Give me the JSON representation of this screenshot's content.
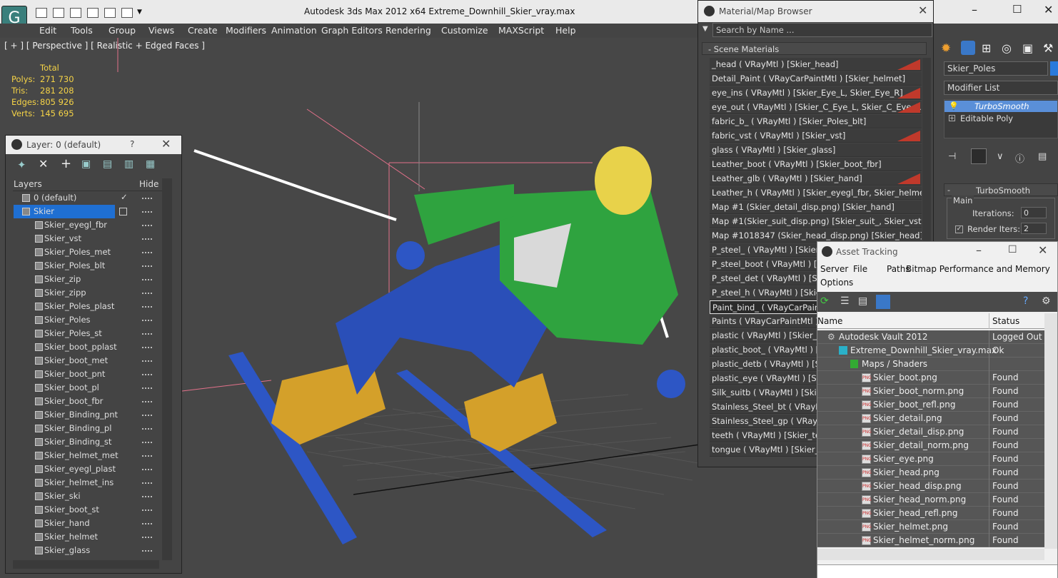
{
  "app": {
    "title": "Autodesk 3ds Max  2012 x64     Extreme_Downhill_Skier_vray.max"
  },
  "menu": [
    "Edit",
    "Tools",
    "Group",
    "Views",
    "Create",
    "Modifiers",
    "Animation",
    "Graph Editors",
    "Rendering",
    "Customize",
    "MAXScript",
    "Help"
  ],
  "viewport": {
    "label": "[ + ] [ Perspective ] [ Realistic + Edged Faces ]",
    "stats": {
      "header": "Total",
      "polys_label": "Polys:",
      "polys": "271 730",
      "tris_label": "Tris:",
      "tris": "281 208",
      "edges_label": "Edges:",
      "edges": "805 926",
      "verts_label": "Verts:",
      "verts": "145 695"
    }
  },
  "layer_panel": {
    "title": "Layer: 0 (default)",
    "help": "?",
    "col_layers": "Layers",
    "col_hide": "Hide",
    "rows": [
      "0 (default)",
      "Skier",
      "Skier_eyegl_fbr",
      "Skier_vst",
      "Skier_Poles_met",
      "Skier_Poles_blt",
      "Skier_zip",
      "Skier_zipp",
      "Skier_Poles_plast",
      "Skier_Poles",
      "Skier_Poles_st",
      "Skier_boot_pplast",
      "Skier_boot_met",
      "Skier_boot_pnt",
      "Skier_boot_pl",
      "Skier_boot_fbr",
      "Skier_Binding_pnt",
      "Skier_Binding_pl",
      "Skier_Binding_st",
      "Skier_helmet_met",
      "Skier_eyegl_plast",
      "Skier_helmet_ins",
      "Skier_ski",
      "Skier_boot_st",
      "Skier_hand",
      "Skier_helmet",
      "Skier_glass"
    ]
  },
  "material_browser": {
    "title": "Material/Map Browser",
    "search_placeholder": "Search by Name ...",
    "section": "- Scene Materials",
    "rows": [
      "_head  ( VRayMtl ) [Skier_head]",
      "Detail_Paint  ( VRayCarPaintMtl ) [Skier_helmet]",
      "eye_ins  ( VRayMtl ) [Skier_Eye_L, Skier_Eye_R]",
      "eye_out  ( VRayMtl ) [Skier_C_Eye_L, Skier_C_Eye_R]",
      "fabric_b_  ( VRayMtl ) [Skier_Poles_blt]",
      "fabric_vst  ( VRayMtl ) [Skier_vst]",
      "glass  ( VRayMtl ) [Skier_glass]",
      "Leather_boot  ( VRayMtl ) [Skier_boot_fbr]",
      "Leather_glb  ( VRayMtl ) [Skier_hand]",
      "Leather_h  ( VRayMtl ) [Skier_eyegl_fbr, Skier_helmet_...",
      "Map #1 (Skier_detail_disp.png) [Skier_hand]",
      "Map #1(Skier_suit_disp.png) [Skier_suit_, Skier_vst]",
      "Map #1018347 (Skier_head_disp.png) [Skier_head]",
      "P_steel_  ( VRayMtl ) [Skier_",
      "P_steel_boot  ( VRayMtl ) [S",
      "P_steel_det  ( VRayMtl ) [Sk",
      "P_steel_h  ( VRayMtl ) [Skie",
      "Paint_bind_  ( VRayCarPaint",
      "Paints  ( VRayCarPaintMtl ) [",
      "plastic  ( VRayMtl ) [Skier_Bi",
      "plastic_boot_  ( VRayMtl ) [S",
      "plastic_detb  ( VRayMtl ) [Sk",
      "plastic_eye  ( VRayMtl ) [Ski",
      "Silk_suitb  ( VRayMtl ) [Skie",
      "Stainless_Steel_bt  ( VRayM",
      "Stainless_Steel_gp  ( VRayM",
      "teeth  ( VRayMtl ) [Skier_tee",
      "tongue  ( VRayMtl ) [Skier_c"
    ],
    "red_rows": [
      0,
      2,
      3,
      5,
      8
    ]
  },
  "command_panel": {
    "object_name": "Skier_Poles",
    "modifier_list": "Modifier List",
    "stack": [
      "TurboSmooth",
      "Editable Poly"
    ],
    "rollout": "TurboSmooth",
    "main": "Main",
    "iterations_label": "Iterations:",
    "iterations": "0",
    "render_iters_label": "Render Iters:",
    "render_iters": "2"
  },
  "asset_tracking": {
    "title": "Asset Tracking",
    "menu": [
      "Server",
      "File",
      "Paths",
      "Bitmap Performance and Memory",
      "Options"
    ],
    "col_name": "Name",
    "col_status": "Status",
    "rows": [
      {
        "name": "Autodesk Vault 2012",
        "status": "Logged Out ."
      },
      {
        "name": "Extreme_Downhill_Skier_vray.max",
        "status": "Ok"
      },
      {
        "name": "Maps / Shaders",
        "status": ""
      },
      {
        "name": "Skier_boot.png",
        "status": "Found"
      },
      {
        "name": "Skier_boot_norm.png",
        "status": "Found"
      },
      {
        "name": "Skier_boot_refl.png",
        "status": "Found"
      },
      {
        "name": "Skier_detail.png",
        "status": "Found"
      },
      {
        "name": "Skier_detail_disp.png",
        "status": "Found"
      },
      {
        "name": "Skier_detail_norm.png",
        "status": "Found"
      },
      {
        "name": "Skier_eye.png",
        "status": "Found"
      },
      {
        "name": "Skier_head.png",
        "status": "Found"
      },
      {
        "name": "Skier_head_disp.png",
        "status": "Found"
      },
      {
        "name": "Skier_head_norm.png",
        "status": "Found"
      },
      {
        "name": "Skier_head_refl.png",
        "status": "Found"
      },
      {
        "name": "Skier_helmet.png",
        "status": "Found"
      },
      {
        "name": "Skier_helmet_norm.png",
        "status": "Found"
      }
    ]
  }
}
